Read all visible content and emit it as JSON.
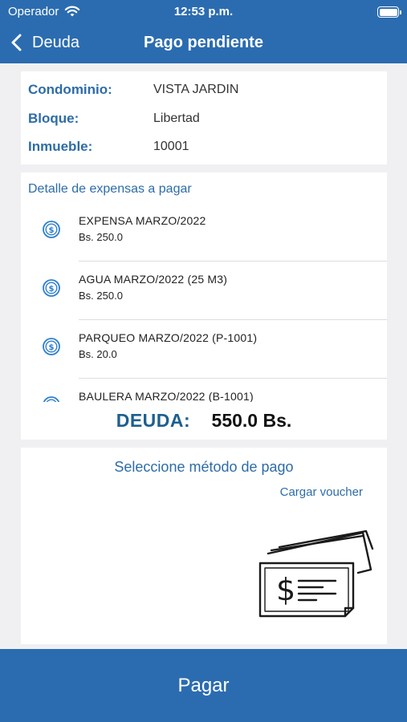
{
  "status_bar": {
    "carrier": "Operador",
    "time": "12:53 p.m."
  },
  "nav": {
    "back_label": "Deuda",
    "title": "Pago pendiente"
  },
  "info": [
    {
      "label": "Condominio:",
      "value": "VISTA JARDIN"
    },
    {
      "label": "Bloque:",
      "value": "Libertad"
    },
    {
      "label": "Inmueble:",
      "value": "10001"
    }
  ],
  "detail": {
    "title": "Detalle de expensas a pagar",
    "items": [
      {
        "name": "EXPENSA MARZO/2022",
        "amount": "Bs. 250.0",
        "icon": "dollar-circle-icon"
      },
      {
        "name": "AGUA MARZO/2022 (25 M3)",
        "amount": "Bs. 250.0",
        "icon": "dollar-circle-icon"
      },
      {
        "name": "PARQUEO MARZO/2022 (P-1001)",
        "amount": "Bs. 20.0",
        "icon": "dollar-circle-icon"
      },
      {
        "name": "BAULERA MARZO/2022 (B-1001)",
        "amount": "",
        "icon": "dollar-circle-icon"
      }
    ],
    "total_label": "DEUDA:",
    "total_value": "550.0 Bs."
  },
  "payment": {
    "title": "Seleccione método de pago",
    "voucher_label": "Cargar voucher",
    "illustration": "money-bills-icon"
  },
  "pay_button_label": "Pagar",
  "colors": {
    "primary": "#2b6cb0",
    "label_blue": "#2d6ca8",
    "background": "#f0f0f2"
  }
}
